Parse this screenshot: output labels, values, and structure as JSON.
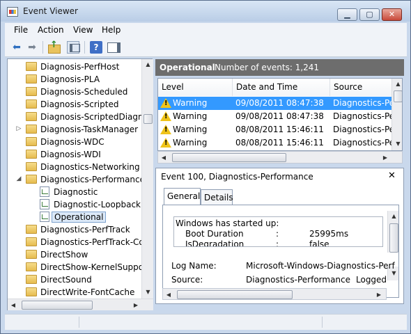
{
  "window": {
    "title": "Event Viewer"
  },
  "menu": [
    "File",
    "Action",
    "View",
    "Help"
  ],
  "tree": {
    "items": [
      {
        "label": "Diagnosis-PerfHost",
        "type": "folder",
        "expander": ""
      },
      {
        "label": "Diagnosis-PLA",
        "type": "folder",
        "expander": ""
      },
      {
        "label": "Diagnosis-Scheduled",
        "type": "folder",
        "expander": ""
      },
      {
        "label": "Diagnosis-Scripted",
        "type": "folder",
        "expander": ""
      },
      {
        "label": "Diagnosis-ScriptedDiagnos",
        "type": "folder",
        "expander": ""
      },
      {
        "label": "Diagnosis-TaskManager",
        "type": "folder",
        "expander": "▷"
      },
      {
        "label": "Diagnosis-WDC",
        "type": "folder",
        "expander": ""
      },
      {
        "label": "Diagnosis-WDI",
        "type": "folder",
        "expander": ""
      },
      {
        "label": "Diagnostics-Networking",
        "type": "folder",
        "expander": ""
      },
      {
        "label": "Diagnostics-Performance",
        "type": "folder",
        "expander": "◢"
      },
      {
        "label": "Diagnostic",
        "type": "log",
        "expander": ""
      },
      {
        "label": "Diagnostic-Loopback",
        "type": "log",
        "expander": ""
      },
      {
        "label": "Operational",
        "type": "log",
        "expander": "",
        "selected": true
      },
      {
        "label": "Diagnostics-PerfTrack",
        "type": "folder",
        "expander": ""
      },
      {
        "label": "Diagnostics-PerfTrack-Cou",
        "type": "folder",
        "expander": ""
      },
      {
        "label": "DirectShow",
        "type": "folder",
        "expander": ""
      },
      {
        "label": "DirectShow-KernelSupport",
        "type": "folder",
        "expander": ""
      },
      {
        "label": "DirectSound",
        "type": "folder",
        "expander": ""
      },
      {
        "label": "DirectWrite-FontCache",
        "type": "folder",
        "expander": ""
      }
    ]
  },
  "log_header": {
    "title": "Operational",
    "count": "Number of events: 1,241"
  },
  "events": {
    "columns": [
      "Level",
      "Date and Time",
      "Source"
    ],
    "rows": [
      {
        "level": "Warning",
        "datetime": "09/08/2011 08:47:38",
        "source": "Diagnostics-Per",
        "selected": true
      },
      {
        "level": "Warning",
        "datetime": "09/08/2011 08:47:38",
        "source": "Diagnostics-Perf"
      },
      {
        "level": "Warning",
        "datetime": "08/08/2011 15:46:11",
        "source": "Diagnostics-Perf"
      },
      {
        "level": "Warning",
        "datetime": "08/08/2011 15:46:11",
        "source": "Diagnostics-Perf"
      }
    ]
  },
  "detail": {
    "title": "Event 100, Diagnostics-Performance",
    "tabs": [
      "General",
      "Details"
    ],
    "message": {
      "heading": "Windows has started up:",
      "lines": [
        {
          "key": "Boot Duration",
          "sep": ":",
          "value": "25995ms"
        },
        {
          "key": "IsDegradation",
          "sep": ":",
          "value": "false"
        }
      ]
    },
    "fields": [
      {
        "label": "Log Name:",
        "value": "Microsoft-Windows-Diagnostics-Perf"
      },
      {
        "label": "Source:",
        "value": "Diagnostics-Performance",
        "extra": "Logged"
      }
    ]
  },
  "colors": {
    "selection": "#3399ff",
    "header_bar": "#6d6d6d",
    "warning": "#f0c419"
  }
}
